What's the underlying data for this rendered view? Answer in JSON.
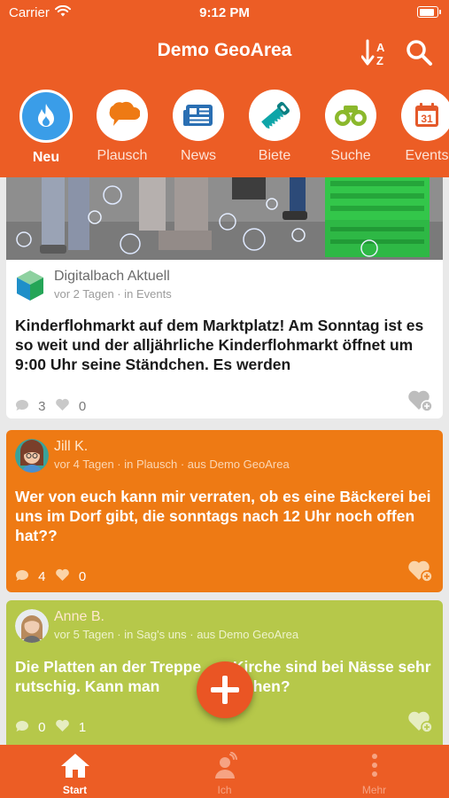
{
  "status_bar": {
    "carrier": "Carrier",
    "time": "9:12 PM"
  },
  "header": {
    "title": "Demo GeoArea",
    "sort_icon": "sort-az-icon",
    "search_icon": "search-icon"
  },
  "categories": [
    {
      "label": "Neu",
      "icon": "flame-icon",
      "active": true
    },
    {
      "label": "Plausch",
      "icon": "speech-bubble-icon",
      "active": false
    },
    {
      "label": "News",
      "icon": "newspaper-icon",
      "active": false
    },
    {
      "label": "Biete",
      "icon": "saw-icon",
      "active": false
    },
    {
      "label": "Suche",
      "icon": "binoculars-icon",
      "active": false
    },
    {
      "label": "Events",
      "icon": "calendar-icon",
      "active": false
    }
  ],
  "calendar_day": "31",
  "posts": [
    {
      "author": "Digitalbach Aktuell",
      "meta": "vor 2 Tagen · in Events",
      "text": "Kinderflohmarkt auf dem Marktplatz! Am Sonntag ist es so weit und der alljährliche Kinderflohmarkt öffnet um 9:00 Uhr seine Ständchen. Es werden",
      "comments": "3",
      "likes": "0",
      "color": "#ffffff"
    },
    {
      "author": "Jill K.",
      "meta": "vor 4 Tagen · in Plausch · aus Demo GeoArea",
      "text": "Wer von euch kann mir verraten, ob es eine Bäckerei bei uns im Dorf gibt, die sonntags nach 12 Uhr noch offen hat??",
      "comments": "4",
      "likes": "0",
      "color": "#ee7a14"
    },
    {
      "author": "Anne B.",
      "meta": "vor 5 Tagen · in Sag's uns · aus Demo GeoArea",
      "text_before": "Die Platten an der Treppe",
      "text_after": "Kirche sind bei Nässe sehr rutschig. Kann man",
      "text_after2": "s machen?",
      "comments": "0",
      "likes": "1",
      "color": "#b6c84a"
    }
  ],
  "fab": {
    "icon": "plus-icon"
  },
  "tabbar": [
    {
      "label": "Start",
      "icon": "home-icon",
      "active": true
    },
    {
      "label": "Ich",
      "icon": "user-icon",
      "active": false
    },
    {
      "label": "Mehr",
      "icon": "more-dots-icon",
      "active": false
    }
  ],
  "colors": {
    "brand": "#ec5d25",
    "active_category": "#3a9de8",
    "plausch": "#ee7a14",
    "sags_uns": "#b6c84a"
  }
}
